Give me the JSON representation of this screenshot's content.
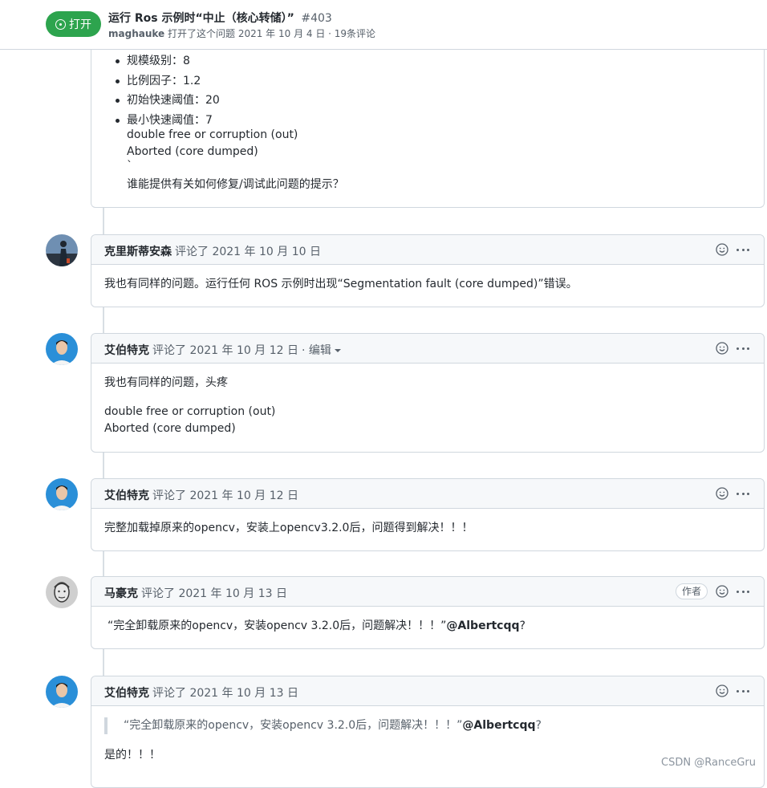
{
  "header": {
    "state_label": "打开",
    "title": "运行 Ros 示例时“中止（核心转储）”",
    "number": "#403",
    "author": "maghauke",
    "meta_text": "打开了这个问题 2021 年 10 月 4 日 · 19条评论"
  },
  "first_comment_tail": {
    "bullets": [
      "规模级别：8",
      "比例因子：1.2",
      "初始快速阈值：20",
      "最小快速阈值：7"
    ],
    "lines": [
      "double free or corruption (out)",
      "Aborted (core dumped)",
      "`",
      "谁能提供有关如何修复/调试此问题的提示？"
    ]
  },
  "comments": [
    {
      "author": "克里斯蒂安森",
      "action": "评论了 2021 年 10 月 10 日",
      "body": "我也有同样的问题。运行任何 ROS 示例时出现“Segmentation fault (core dumped)”错误。"
    },
    {
      "author": "艾伯特克",
      "action": "评论了 2021 年 10 月 12 日",
      "edited": "· 编辑",
      "body_p1": "我也有同样的问题，头疼",
      "body_p2_l1": "double free or corruption (out)",
      "body_p2_l2": "Aborted (core dumped)"
    },
    {
      "author": "艾伯特克",
      "action": "评论了 2021 年 10 月 12 日",
      "body": "完整加载掉原来的opencv，安装上opencv3.2.0后，问题得到解决！！！"
    },
    {
      "author": "马豪克",
      "action": "评论了 2021 年 10 月 13 日",
      "badge": "作者",
      "body_text": "“完全卸载原来的opencv，安装opencv 3.2.0后，问题解决！！！”",
      "mention": "@Albertcqq",
      "tail": "?"
    },
    {
      "author": "艾伯特克",
      "action": "评论了 2021 年 10 月 13 日",
      "quote_text": "“完全卸载原来的opencv，安装opencv 3.2.0后，问题解决！！！”",
      "quote_mention": "@Albertcqq",
      "quote_tail": "?",
      "reply": "是的！！！"
    }
  ],
  "watermark": "CSDN @RanceGru",
  "colors": {
    "open_green": "#2da44e",
    "border": "#d0d7de",
    "header_bg": "#f6f8fa",
    "muted": "#57606a"
  }
}
